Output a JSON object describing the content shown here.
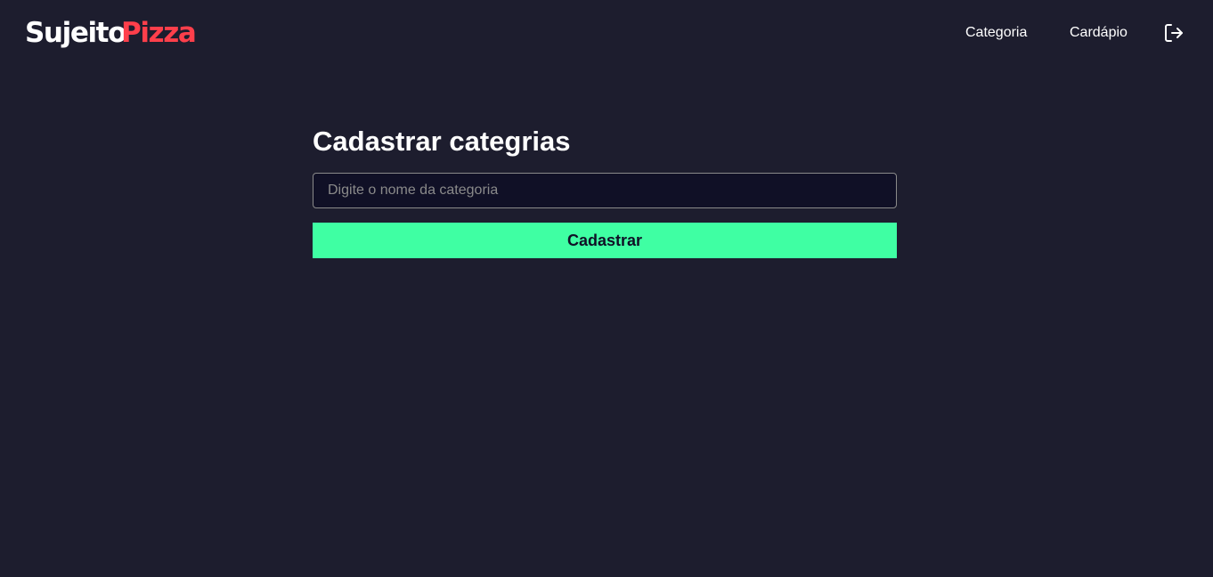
{
  "header": {
    "logo_part_a": "Sujeito",
    "logo_part_b": "Pizza",
    "nav": [
      {
        "label": "Categoria"
      },
      {
        "label": "Cardápio"
      }
    ],
    "logout_icon": "logout-icon"
  },
  "main": {
    "title": "Cadastrar categrias",
    "input": {
      "placeholder": "Digite o nome da categoria",
      "value": ""
    },
    "submit_label": "Cadastrar"
  },
  "colors": {
    "background": "#1d1d2e",
    "brand_red": "#ff3f4b",
    "accent_green": "#3fffa3",
    "input_bg": "#101026"
  }
}
